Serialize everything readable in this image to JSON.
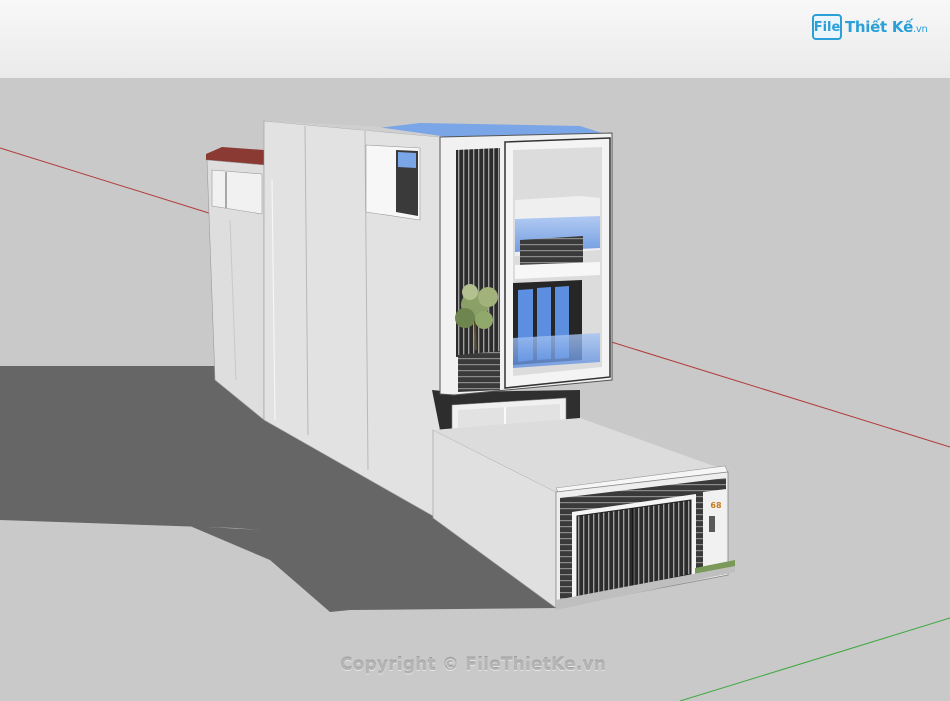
{
  "watermark": {
    "logo_box": "File",
    "logo_text": "Thiết Kế",
    "logo_suffix": ".vn",
    "copyright": "Copyright © FileThietKe.vn"
  },
  "building": {
    "house_number": "68"
  },
  "colors": {
    "sky": "#f2f2f2",
    "ground": "#c9c9c9",
    "shadow": "#666666",
    "wall": "#e4e4e4",
    "dark": "#333333",
    "glass": "#7aa5e6",
    "red_axis": "#b23a3a",
    "green_axis": "#3fa83f"
  }
}
